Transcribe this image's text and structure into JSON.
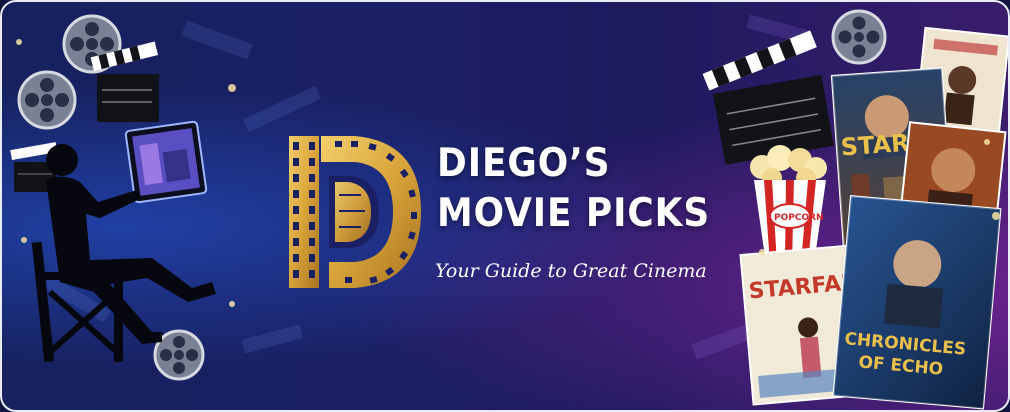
{
  "brand": {
    "title_line_1": "DIEGO’S",
    "title_line_2": "MOVIE PICKS",
    "tagline": "Your Guide to Great Cinema"
  },
  "posters": {
    "starfall_top": "STARFALL",
    "starfall_bottom": "STARFALL",
    "chronicles_line_1": "CHRONICLES",
    "chronicles_line_2": "OF ECHO"
  },
  "popcorn_label": "POPCORN",
  "colors": {
    "gold": "#d9a43a",
    "gold_light": "#f1cf6b",
    "background_left": "#16215e",
    "background_right": "#3a1d6b",
    "border": "#e9ecf5"
  },
  "icons": [
    "film-reel-icon",
    "clapperboard-icon",
    "popcorn-icon",
    "director-chair-icon",
    "monitor-icon"
  ]
}
